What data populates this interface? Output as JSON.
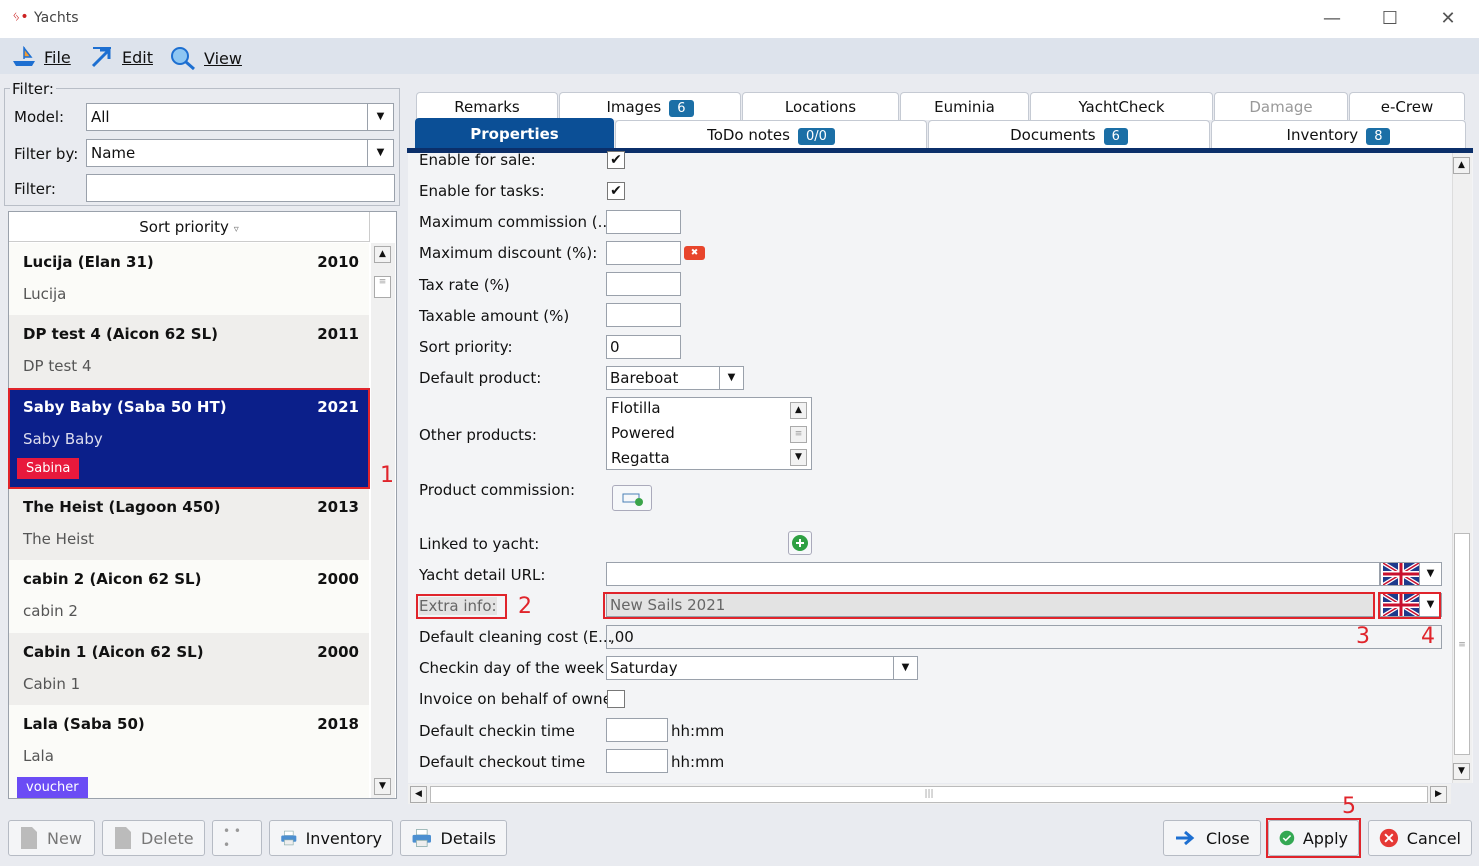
{
  "window": {
    "title": "Yachts",
    "minimize": "—",
    "maximize": "☐",
    "close": "✕"
  },
  "menu": {
    "file": "File",
    "edit": "Edit",
    "view": "View"
  },
  "filter": {
    "legend": "Filter:",
    "model_label": "Model:",
    "model_value": "All",
    "filterby_label": "Filter by:",
    "filterby_value": "Name",
    "filter_label": "Filter:",
    "filter_value": ""
  },
  "list": {
    "header": "Sort priority",
    "items": [
      {
        "name": "Lucija (Elan 31)",
        "year": "2010",
        "sub": "Lucija"
      },
      {
        "name": "DP test 4 (Aicon 62 SL)",
        "year": "2011",
        "sub": "DP test 4"
      },
      {
        "name": "Saby Baby (Saba 50 HT)",
        "year": "2021",
        "sub": "Saby Baby",
        "tag": "Sabina"
      },
      {
        "name": "The Heist (Lagoon 450)",
        "year": "2013",
        "sub": "The Heist"
      },
      {
        "name": "cabin 2 (Aicon 62 SL)",
        "year": "2000",
        "sub": "cabin 2"
      },
      {
        "name": "Cabin 1 (Aicon 62 SL)",
        "year": "2000",
        "sub": "Cabin 1"
      },
      {
        "name": "Lala (Saba 50)",
        "year": "2018",
        "sub": "Lala",
        "tag": "voucher"
      }
    ]
  },
  "tabs": {
    "row1": [
      {
        "label": "Remarks"
      },
      {
        "label": "Images",
        "badge": "6"
      },
      {
        "label": "Locations"
      },
      {
        "label": "Euminia"
      },
      {
        "label": "YachtCheck"
      },
      {
        "label": "Damage"
      },
      {
        "label": "e-Crew"
      }
    ],
    "row2": [
      {
        "label": "Properties"
      },
      {
        "label": "ToDo notes",
        "badge": "0/0"
      },
      {
        "label": "Documents",
        "badge": "6"
      },
      {
        "label": "Inventory",
        "badge": "8"
      }
    ]
  },
  "props": {
    "enable_sale": "Enable for sale:",
    "enable_tasks": "Enable for tasks:",
    "max_commission": "Maximum commission (...",
    "max_discount": "Maximum discount (%):",
    "tax_rate": "Tax rate (%)",
    "taxable_amount": "Taxable amount (%)",
    "sort_priority": "Sort priority:",
    "sort_priority_value": "0",
    "default_product": "Default product:",
    "default_product_value": "Bareboat",
    "other_products": "Other products:",
    "other_products_list": [
      "Flotilla",
      "Powered",
      "Regatta"
    ],
    "product_commission": "Product commission:",
    "linked_yacht": "Linked to yacht:",
    "detail_url": "Yacht detail URL:",
    "detail_url_value": "",
    "extra_info": "Extra info:",
    "extra_info_value": "New Sails 2021",
    "cleaning_cost": "Default cleaning cost (E...",
    "cleaning_cost_value": ",00",
    "checkin_day": "Checkin day of the week",
    "checkin_day_value": "Saturday",
    "invoice_owner": "Invoice on behalf of owne",
    "checkin_time": "Default checkin time",
    "checkout_time": "Default checkout time",
    "hhmm": "hh:mm"
  },
  "annotations": [
    "1",
    "2",
    "3",
    "4",
    "5"
  ],
  "buttons": {
    "new": "New",
    "delete": "Delete",
    "more": "• • •",
    "inventory": "Inventory",
    "details": "Details",
    "close": "Close",
    "apply": "Apply",
    "cancel": "Cancel"
  },
  "colors": {
    "selected": "#0b1f8a",
    "tab_active": "#0b4f96",
    "badge": "#1b6fa6",
    "tag_red": "#e8193c",
    "tag_purple": "#6b4cf5",
    "annotation": "#e0242b"
  }
}
